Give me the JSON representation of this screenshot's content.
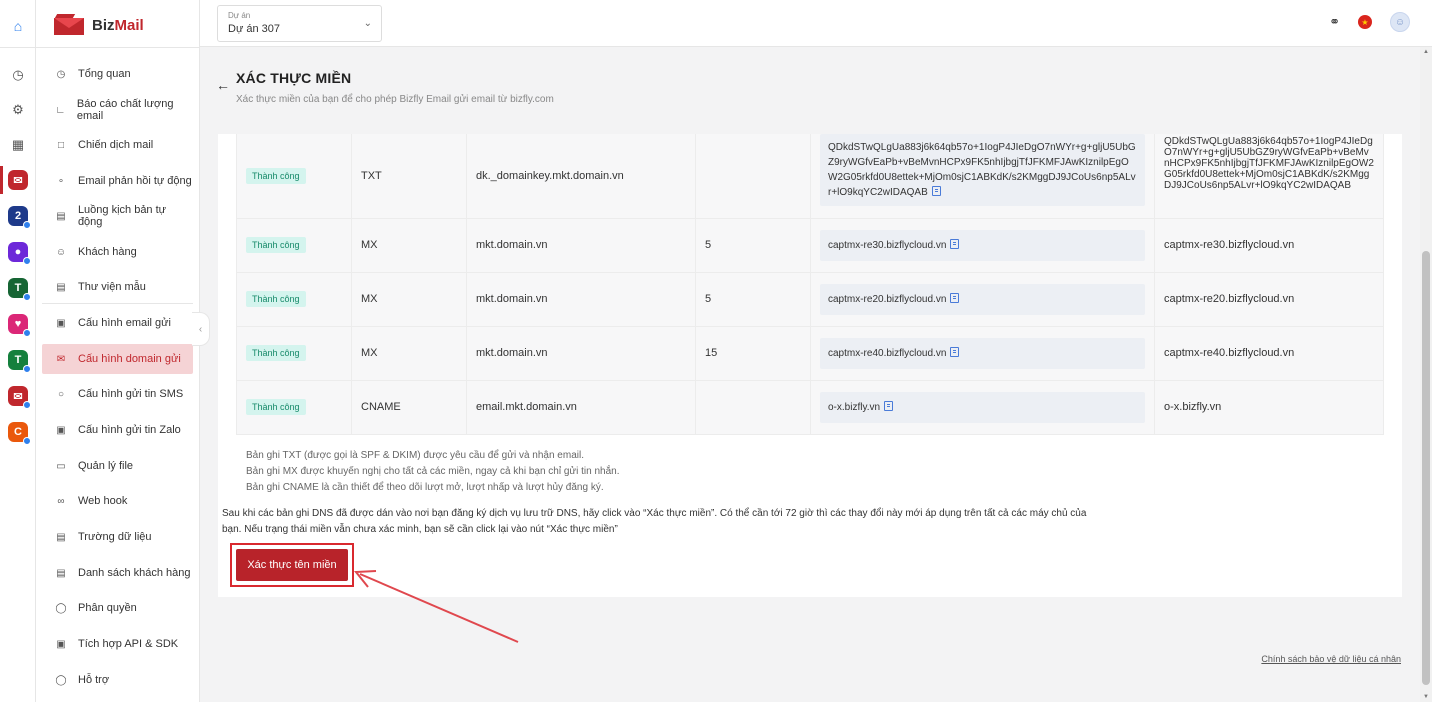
{
  "brand": {
    "name_a": "Biz",
    "name_b": "Mail"
  },
  "project": {
    "label": "Dự án",
    "value": "Dự án 307"
  },
  "nav": [
    {
      "label": "Tổng quan"
    },
    {
      "label": "Báo cáo chất lượng email"
    },
    {
      "label": "Chiến dịch mail"
    },
    {
      "label": "Email phản hồi tự động"
    },
    {
      "label": "Luồng kịch bản tự động"
    },
    {
      "label": "Khách hàng"
    },
    {
      "label": "Thư viện mẫu"
    },
    {
      "label": "Cấu hình email gửi"
    },
    {
      "label": "Cấu hình domain gửi"
    },
    {
      "label": "Cấu hình gửi tin SMS"
    },
    {
      "label": "Cấu hình gửi tin Zalo"
    },
    {
      "label": "Quản lý file"
    },
    {
      "label": "Web hook"
    },
    {
      "label": "Trường dữ liệu"
    },
    {
      "label": "Danh sách khách hàng"
    },
    {
      "label": "Phân quyền"
    },
    {
      "label": "Tích hợp API & SDK"
    },
    {
      "label": "Hỗ trợ"
    }
  ],
  "page": {
    "title": "XÁC THỰC MIỀN",
    "subtitle": "Xác thực miền của bạn để cho phép Bizfly Email gửi email từ bizfly.com"
  },
  "records": [
    {
      "status": "Thành công",
      "type": "TXT",
      "host": "dk._domainkey.mkt.domain.vn",
      "priority": "",
      "value": "QDkdSTwQLgUa883j6k64qb57o+1IogP4JIeDgO7nWYr+g+gljU5UbGZ9ryWGfvEaPb+vBeMvnHCPx9FK5nhIjbgjTfJFKMFJAwKIznilpEgOW2G05rkfd0U8ettek+MjOm0sjC1ABKdK/s2KMggDJ9JCoUs6np5ALvr+lO9kqYC2wIDAQAB",
      "current": "QDkdSTwQLgUa883j6k64qb57o+1IogP4JIeDgO7nWYr+g+gljU5UbGZ9ryWGfvEaPb+vBeMvnHCPx9FK5nhIjbgjTfJFKMFJAwKIznilpEgOW2G05rkfd0U8ettek+MjOm0sjC1ABKdK/s2KMggDJ9JCoUs6np5ALvr+lO9kqYC2wIDAQAB"
    },
    {
      "status": "Thành công",
      "type": "MX",
      "host": "mkt.domain.vn",
      "priority": "5",
      "value": "captmx-re30.bizflycloud.vn",
      "current": "captmx-re30.bizflycloud.vn"
    },
    {
      "status": "Thành công",
      "type": "MX",
      "host": "mkt.domain.vn",
      "priority": "5",
      "value": "captmx-re20.bizflycloud.vn",
      "current": "captmx-re20.bizflycloud.vn"
    },
    {
      "status": "Thành công",
      "type": "MX",
      "host": "mkt.domain.vn",
      "priority": "15",
      "value": "captmx-re40.bizflycloud.vn",
      "current": "captmx-re40.bizflycloud.vn"
    },
    {
      "status": "Thành công",
      "type": "CNAME",
      "host": "email.mkt.domain.vn",
      "priority": "",
      "value": "o-x.bizfly.vn",
      "current": "o-x.bizfly.vn"
    }
  ],
  "notes": [
    "Bản ghi TXT (được gọi là SPF & DKIM) được yêu cầu để gửi và nhận email.",
    "Bản ghi MX được khuyến nghị cho tất cả các miền, ngay cả khi bạn chỉ gửi tin nhắn.",
    "Bản ghi CNAME là cần thiết để theo dõi lượt mở, lượt nhấp và lượt hủy đăng ký."
  ],
  "info": "Sau khi các bản ghi DNS đã được dán vào nơi bạn đăng ký dịch vụ lưu trữ DNS, hãy click vào “Xác thực miền”. Có thể cần tới 72 giờ thì các thay đổi này mới áp dụng trên tất cả các máy chủ của bạn. Nếu trạng thái miền vẫn chưa xác minh, bạn sẽ cần click lại vào nút “Xác thực miền”",
  "verify_button": "Xác thực tên miền",
  "footer_link": "Chính sách bảo vệ dữ liệu cá nhân",
  "colors": {
    "accent": "#c0272d",
    "success_bg": "#d4f4ee",
    "success_text": "#178a6a"
  }
}
